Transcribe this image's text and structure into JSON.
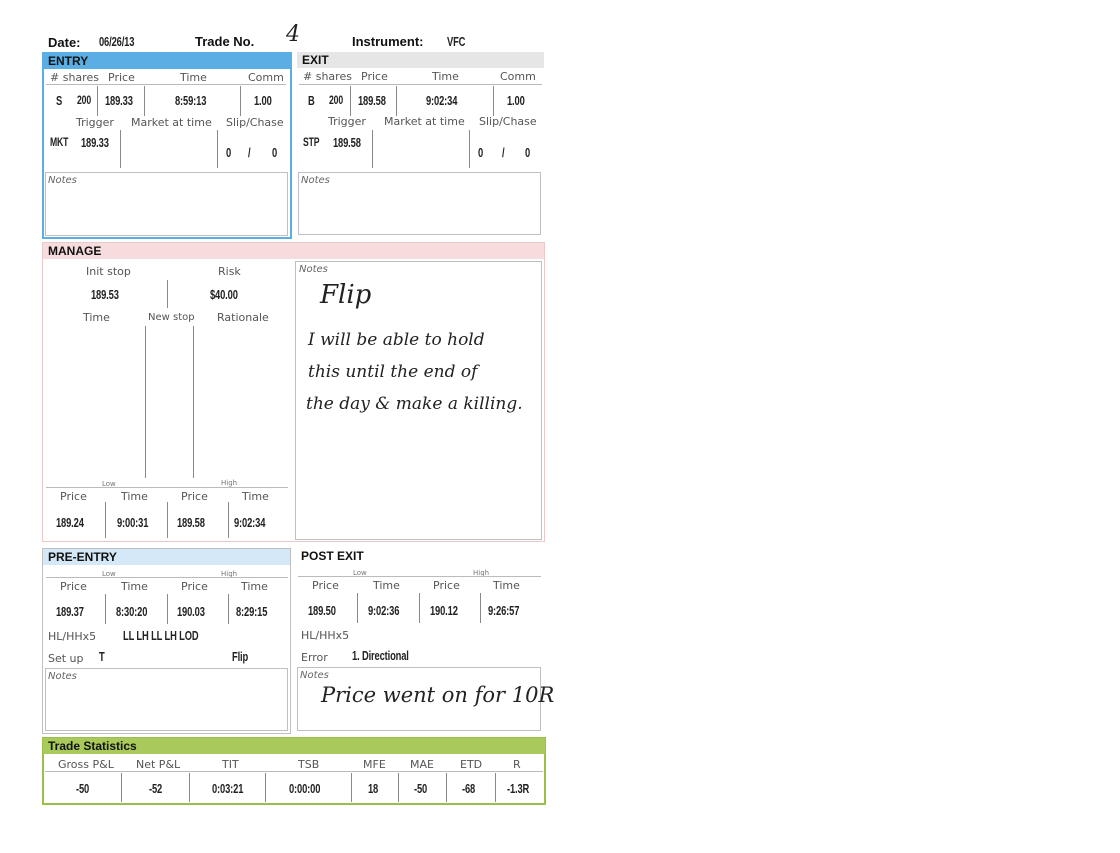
{
  "header": {
    "date_label": "Date:",
    "date_value": "06/26/13",
    "trade_label": "Trade No.",
    "trade_value": "4",
    "instrument_label": "Instrument:",
    "instrument_value": "VFC"
  },
  "entry": {
    "title": "ENTRY",
    "cols": [
      "# shares",
      "Price",
      "Time",
      "Comm"
    ],
    "side": "S",
    "shares": "200",
    "price": "189.33",
    "time": "8:59:13",
    "comm": "1.00",
    "labels2": [
      "Trigger",
      "Market at time",
      "Slip/Chase"
    ],
    "trigger_type": "MKT",
    "trigger_price": "189.33",
    "slip": "0",
    "slash": "/",
    "chase": "0",
    "notes_label": "Notes"
  },
  "exit": {
    "title": "EXIT",
    "cols": [
      "# shares",
      "Price",
      "Time",
      "Comm"
    ],
    "side": "B",
    "shares": "200",
    "price": "189.58",
    "time": "9:02:34",
    "comm": "1.00",
    "labels2": [
      "Trigger",
      "Market at time",
      "Slip/Chase"
    ],
    "trigger_type": "STP",
    "trigger_price": "189.58",
    "slip": "0",
    "slash": "/",
    "chase": "0",
    "notes_label": "Notes"
  },
  "manage": {
    "title": "MANAGE",
    "init_stop_label": "Init stop",
    "risk_label": "Risk",
    "init_stop": "189.53",
    "risk": "$40.00",
    "time_label": "Time",
    "new_stop_label": "New stop",
    "rationale_label": "Rationale",
    "low_label": "Low",
    "high_label": "High",
    "sub_cols": [
      "Price",
      "Time",
      "Price",
      "Time"
    ],
    "low_price": "189.24",
    "low_time": "9:00:31",
    "high_price": "189.58",
    "high_time": "9:02:34",
    "notes_label": "Notes",
    "notes_hand": [
      "Flip",
      "I will be able to hold",
      "this until the end of",
      "the day & make a killing."
    ]
  },
  "pre_entry": {
    "title": "PRE-ENTRY",
    "low_label": "Low",
    "high_label": "High",
    "sub_cols": [
      "Price",
      "Time",
      "Price",
      "Time"
    ],
    "low_price": "189.37",
    "low_time": "8:30:20",
    "high_price": "190.03",
    "high_time": "8:29:15",
    "hl_label": "HL/HHx5",
    "hl_value": "LL LH LL LH LOD",
    "setup_label": "Set up",
    "setup_value": "T",
    "setup_name": "Flip",
    "notes_label": "Notes"
  },
  "post_exit": {
    "title": "POST EXIT",
    "low_label": "Low",
    "high_label": "High",
    "sub_cols": [
      "Price",
      "Time",
      "Price",
      "Time"
    ],
    "low_price": "189.50",
    "low_time": "9:02:36",
    "high_price": "190.12",
    "high_time": "9:26:57",
    "hl_label": "HL/HHx5",
    "error_label": "Error",
    "error_value": "1. Directional",
    "notes_label": "Notes",
    "notes_hand": "Price went on for 10R"
  },
  "stats": {
    "title": "Trade Statistics",
    "cols": [
      "Gross P&L",
      "Net P&L",
      "TIT",
      "TSB",
      "MFE",
      "MAE",
      "ETD",
      "R"
    ],
    "values": [
      "-50",
      "-52",
      "0:03:21",
      "0:00:00",
      "18",
      "-50",
      "-68",
      "-1.3R"
    ]
  },
  "colors": {
    "entry_bar": "#5aaee4",
    "exit_bar": "#e6e6e6",
    "manage_bar": "#f6dcdc",
    "pre_entry_bar": "#d4e8f7",
    "stats_bar": "#a9c95a",
    "stats_border": "#9bbf4b",
    "entry_border": "#5aaee4"
  }
}
